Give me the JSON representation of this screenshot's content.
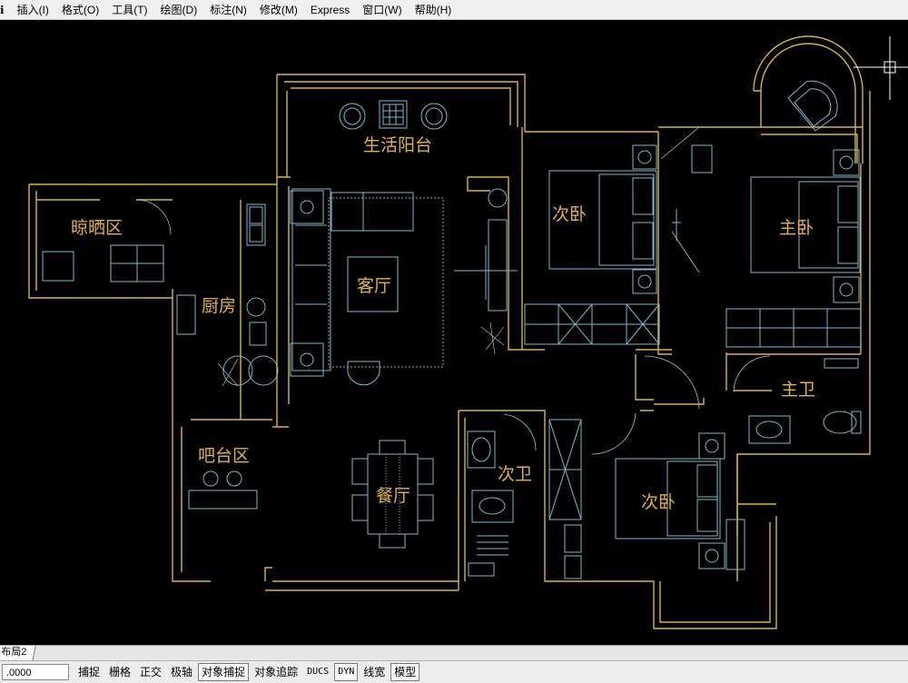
{
  "menu": {
    "items": [
      "ℹ",
      "插入(I)",
      "格式(O)",
      "工具(T)",
      "绘图(D)",
      "标注(N)",
      "修改(M)",
      "Express",
      "窗口(W)",
      "帮助(H)"
    ]
  },
  "drawing": {
    "background": "#000000",
    "wall_color": "#d9b24a",
    "furniture_color": "#7fb8c8",
    "rooms": {
      "balcony": "生活阳台",
      "drying": "晾晒区",
      "kitchen": "厨房",
      "living": "客厅",
      "bedroom_a": "次卧",
      "master_bedroom": "主卧",
      "master_bath": "主卫",
      "bar": "吧台区",
      "dining": "餐厅",
      "bath_b": "次卫",
      "bedroom_b": "次卧"
    }
  },
  "layout_tab": {
    "label": "布局2"
  },
  "status": {
    "coordinates": ".0000",
    "toggles": [
      {
        "label": "捕捉",
        "on": false
      },
      {
        "label": "栅格",
        "on": false
      },
      {
        "label": "正交",
        "on": false
      },
      {
        "label": "极轴",
        "on": false
      },
      {
        "label": "对象捕捉",
        "on": true
      },
      {
        "label": "对象追踪",
        "on": false
      },
      {
        "label": "DUCS",
        "on": false
      },
      {
        "label": "DYN",
        "on": true
      },
      {
        "label": "线宽",
        "on": false
      },
      {
        "label": "模型",
        "on": true
      }
    ]
  }
}
